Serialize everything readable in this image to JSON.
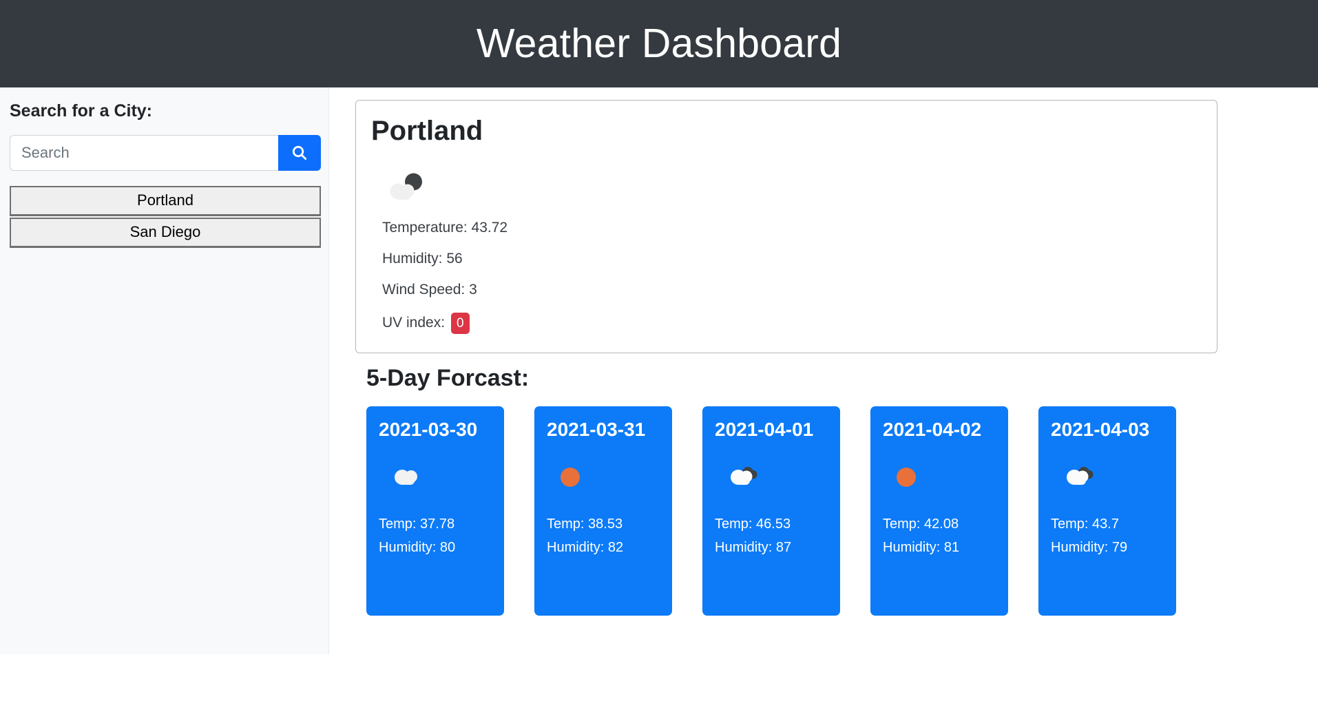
{
  "header": {
    "title": "Weather Dashboard",
    "background_color": "#343a40"
  },
  "sidebar": {
    "title": "Search for a City:",
    "search": {
      "value": "",
      "placeholder": "Search",
      "button_icon": "search-icon",
      "button_color": "#0d6efd"
    },
    "cities": [
      {
        "label": "Portland"
      },
      {
        "label": "San Diego"
      }
    ]
  },
  "current": {
    "city": "Portland",
    "icon": "broken-clouds-icon",
    "temperature_label": "Temperature: 43.72",
    "humidity_label": "Humidity: 56",
    "wind_label": "Wind Speed: 3",
    "uv_label": "UV index:",
    "uv_value": "0",
    "uv_badge_color": "#dc3545"
  },
  "forecast": {
    "title": "5-Day Forcast:",
    "card_color": "#0d7bf7",
    "days": [
      {
        "date": "2021-03-30",
        "icon": "cloud-icon",
        "temp": "Temp: 37.78",
        "humidity": "Humidity: 80"
      },
      {
        "date": "2021-03-31",
        "icon": "sun-icon",
        "temp": "Temp: 38.53",
        "humidity": "Humidity: 82"
      },
      {
        "date": "2021-04-01",
        "icon": "broken-clouds-icon",
        "temp": "Temp: 46.53",
        "humidity": "Humidity: 87"
      },
      {
        "date": "2021-04-02",
        "icon": "sun-icon",
        "temp": "Temp: 42.08",
        "humidity": "Humidity: 81"
      },
      {
        "date": "2021-04-03",
        "icon": "broken-clouds-icon",
        "temp": "Temp: 43.7",
        "humidity": "Humidity: 79"
      }
    ]
  }
}
